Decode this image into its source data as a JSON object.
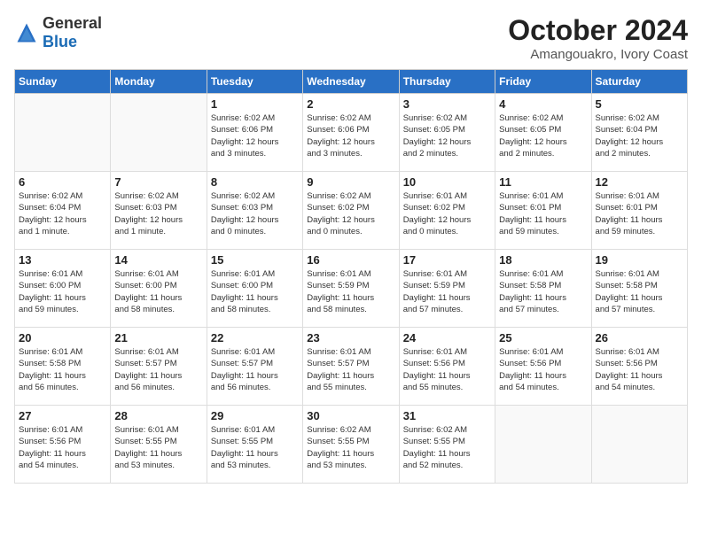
{
  "header": {
    "logo_general": "General",
    "logo_blue": "Blue",
    "month_title": "October 2024",
    "location": "Amangouakro, Ivory Coast"
  },
  "days_of_week": [
    "Sunday",
    "Monday",
    "Tuesday",
    "Wednesday",
    "Thursday",
    "Friday",
    "Saturday"
  ],
  "weeks": [
    [
      {
        "day": "",
        "info": ""
      },
      {
        "day": "",
        "info": ""
      },
      {
        "day": "1",
        "info": "Sunrise: 6:02 AM\nSunset: 6:06 PM\nDaylight: 12 hours\nand 3 minutes."
      },
      {
        "day": "2",
        "info": "Sunrise: 6:02 AM\nSunset: 6:06 PM\nDaylight: 12 hours\nand 3 minutes."
      },
      {
        "day": "3",
        "info": "Sunrise: 6:02 AM\nSunset: 6:05 PM\nDaylight: 12 hours\nand 2 minutes."
      },
      {
        "day": "4",
        "info": "Sunrise: 6:02 AM\nSunset: 6:05 PM\nDaylight: 12 hours\nand 2 minutes."
      },
      {
        "day": "5",
        "info": "Sunrise: 6:02 AM\nSunset: 6:04 PM\nDaylight: 12 hours\nand 2 minutes."
      }
    ],
    [
      {
        "day": "6",
        "info": "Sunrise: 6:02 AM\nSunset: 6:04 PM\nDaylight: 12 hours\nand 1 minute."
      },
      {
        "day": "7",
        "info": "Sunrise: 6:02 AM\nSunset: 6:03 PM\nDaylight: 12 hours\nand 1 minute."
      },
      {
        "day": "8",
        "info": "Sunrise: 6:02 AM\nSunset: 6:03 PM\nDaylight: 12 hours\nand 0 minutes."
      },
      {
        "day": "9",
        "info": "Sunrise: 6:02 AM\nSunset: 6:02 PM\nDaylight: 12 hours\nand 0 minutes."
      },
      {
        "day": "10",
        "info": "Sunrise: 6:01 AM\nSunset: 6:02 PM\nDaylight: 12 hours\nand 0 minutes."
      },
      {
        "day": "11",
        "info": "Sunrise: 6:01 AM\nSunset: 6:01 PM\nDaylight: 11 hours\nand 59 minutes."
      },
      {
        "day": "12",
        "info": "Sunrise: 6:01 AM\nSunset: 6:01 PM\nDaylight: 11 hours\nand 59 minutes."
      }
    ],
    [
      {
        "day": "13",
        "info": "Sunrise: 6:01 AM\nSunset: 6:00 PM\nDaylight: 11 hours\nand 59 minutes."
      },
      {
        "day": "14",
        "info": "Sunrise: 6:01 AM\nSunset: 6:00 PM\nDaylight: 11 hours\nand 58 minutes."
      },
      {
        "day": "15",
        "info": "Sunrise: 6:01 AM\nSunset: 6:00 PM\nDaylight: 11 hours\nand 58 minutes."
      },
      {
        "day": "16",
        "info": "Sunrise: 6:01 AM\nSunset: 5:59 PM\nDaylight: 11 hours\nand 58 minutes."
      },
      {
        "day": "17",
        "info": "Sunrise: 6:01 AM\nSunset: 5:59 PM\nDaylight: 11 hours\nand 57 minutes."
      },
      {
        "day": "18",
        "info": "Sunrise: 6:01 AM\nSunset: 5:58 PM\nDaylight: 11 hours\nand 57 minutes."
      },
      {
        "day": "19",
        "info": "Sunrise: 6:01 AM\nSunset: 5:58 PM\nDaylight: 11 hours\nand 57 minutes."
      }
    ],
    [
      {
        "day": "20",
        "info": "Sunrise: 6:01 AM\nSunset: 5:58 PM\nDaylight: 11 hours\nand 56 minutes."
      },
      {
        "day": "21",
        "info": "Sunrise: 6:01 AM\nSunset: 5:57 PM\nDaylight: 11 hours\nand 56 minutes."
      },
      {
        "day": "22",
        "info": "Sunrise: 6:01 AM\nSunset: 5:57 PM\nDaylight: 11 hours\nand 56 minutes."
      },
      {
        "day": "23",
        "info": "Sunrise: 6:01 AM\nSunset: 5:57 PM\nDaylight: 11 hours\nand 55 minutes."
      },
      {
        "day": "24",
        "info": "Sunrise: 6:01 AM\nSunset: 5:56 PM\nDaylight: 11 hours\nand 55 minutes."
      },
      {
        "day": "25",
        "info": "Sunrise: 6:01 AM\nSunset: 5:56 PM\nDaylight: 11 hours\nand 54 minutes."
      },
      {
        "day": "26",
        "info": "Sunrise: 6:01 AM\nSunset: 5:56 PM\nDaylight: 11 hours\nand 54 minutes."
      }
    ],
    [
      {
        "day": "27",
        "info": "Sunrise: 6:01 AM\nSunset: 5:56 PM\nDaylight: 11 hours\nand 54 minutes."
      },
      {
        "day": "28",
        "info": "Sunrise: 6:01 AM\nSunset: 5:55 PM\nDaylight: 11 hours\nand 53 minutes."
      },
      {
        "day": "29",
        "info": "Sunrise: 6:01 AM\nSunset: 5:55 PM\nDaylight: 11 hours\nand 53 minutes."
      },
      {
        "day": "30",
        "info": "Sunrise: 6:02 AM\nSunset: 5:55 PM\nDaylight: 11 hours\nand 53 minutes."
      },
      {
        "day": "31",
        "info": "Sunrise: 6:02 AM\nSunset: 5:55 PM\nDaylight: 11 hours\nand 52 minutes."
      },
      {
        "day": "",
        "info": ""
      },
      {
        "day": "",
        "info": ""
      }
    ]
  ]
}
